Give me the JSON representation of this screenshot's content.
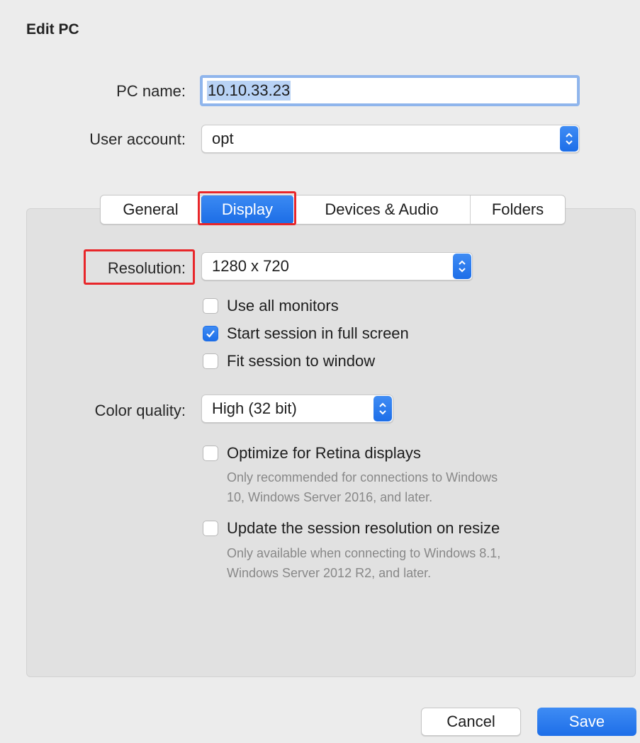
{
  "window": {
    "title": "Edit PC"
  },
  "form": {
    "pc_name_label": "PC name:",
    "pc_name_value": "10.10.33.23",
    "user_account_label": "User account:",
    "user_account_value": "opt"
  },
  "tabs": [
    {
      "label": "General",
      "active": false
    },
    {
      "label": "Display",
      "active": true
    },
    {
      "label": "Devices & Audio",
      "active": false
    },
    {
      "label": "Folders",
      "active": false
    }
  ],
  "display": {
    "resolution_label": "Resolution:",
    "resolution_value": "1280 x 720",
    "color_quality_label": "Color quality:",
    "color_quality_value": "High (32 bit)",
    "checkboxes": [
      {
        "label": "Use all monitors",
        "checked": false
      },
      {
        "label": "Start session in full screen",
        "checked": true
      },
      {
        "label": "Fit session to window",
        "checked": false
      }
    ],
    "retina": {
      "label": "Optimize for Retina displays",
      "checked": false,
      "hint_line1": "Only recommended for connections to Windows",
      "hint_line2": "10, Windows Server 2016, and later."
    },
    "resize": {
      "label": "Update the session resolution on resize",
      "checked": false,
      "hint_line1": "Only available when connecting to Windows 8.1,",
      "hint_line2": "Windows Server 2012 R2, and later."
    }
  },
  "buttons": {
    "cancel": "Cancel",
    "save": "Save"
  },
  "colors": {
    "accent": "#1d6ee8",
    "highlight_box": "#e8262a",
    "panel": "#e1e1e1"
  },
  "icons": {
    "popup_arrow": "updown-chevron-icon",
    "checkmark": "checkmark-icon"
  }
}
